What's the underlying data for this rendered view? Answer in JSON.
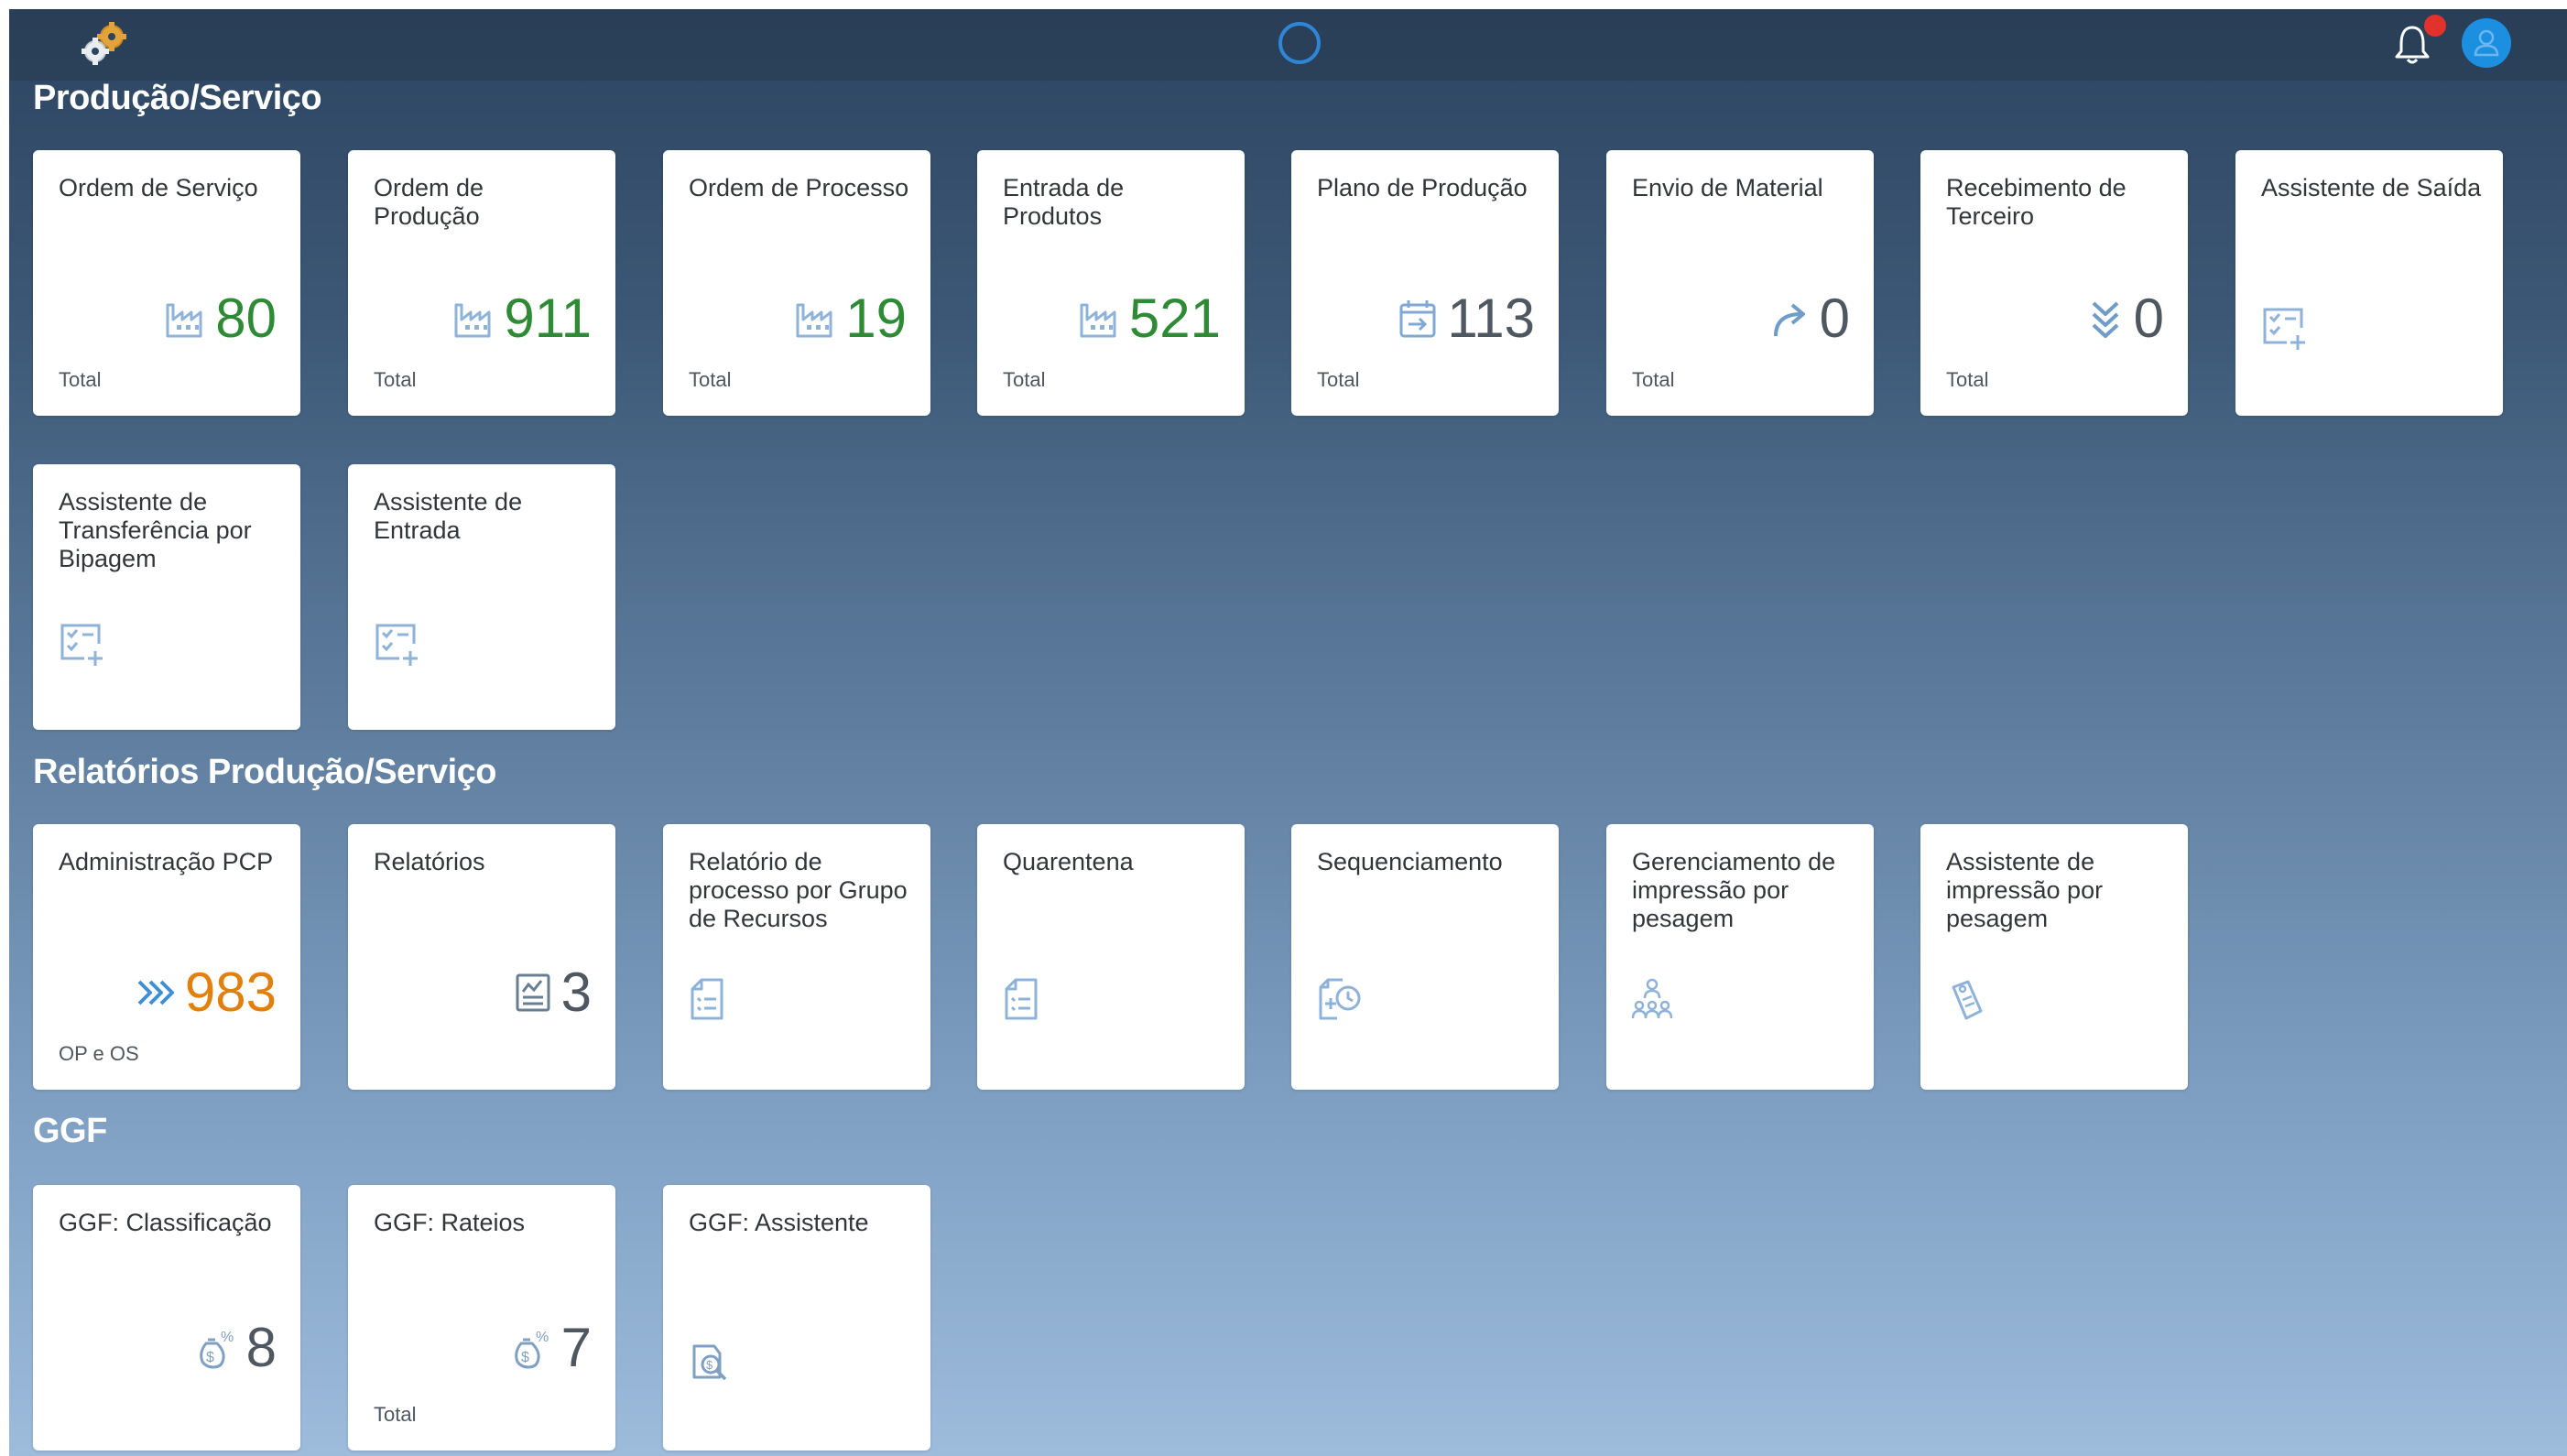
{
  "header": {
    "logo_icon": "gears-logo-icon",
    "loading_icon": "busy-indicator-icon",
    "notifications_icon": "bell-icon",
    "avatar_icon": "user-avatar-icon"
  },
  "colors": {
    "kpi_green": "#2f8a36",
    "kpi_orange": "#e0800f",
    "kpi_neutral": "#4f5760",
    "icon_blue": "#5b93c8",
    "avatar": "#1d8fe0",
    "badge": "#e3322b"
  },
  "sections": [
    {
      "title": "Produção/Serviço",
      "tiles": [
        {
          "title": "Ordem de Serviço",
          "value": "80",
          "icon": "factory-icon",
          "footer": "Total"
        },
        {
          "title": "Ordem de Produção",
          "value": "911",
          "icon": "factory-icon",
          "footer": "Total"
        },
        {
          "title": "Ordem de Processo",
          "value": "19",
          "icon": "factory-icon",
          "footer": "Total"
        },
        {
          "title": "Entrada de Produtos",
          "value": "521",
          "icon": "factory-icon",
          "footer": "Total"
        },
        {
          "title": "Plano de Produção",
          "value": "113",
          "icon": "calendar-arrow-icon",
          "footer": "Total"
        },
        {
          "title": "Envio de Material",
          "value": "0",
          "icon": "forward-arrow-icon",
          "footer": "Total"
        },
        {
          "title": "Recebimento de Terceiro",
          "value": "0",
          "icon": "double-chevron-down-icon",
          "footer": "Total"
        },
        {
          "title": "Assistente de Saída",
          "icon": "task-add-icon"
        },
        {
          "title": "Assistente de Transferência por Bipagem",
          "icon": "task-add-icon"
        },
        {
          "title": "Assistente de Entrada",
          "icon": "task-add-icon"
        }
      ]
    },
    {
      "title": "Relatórios Produção/Serviço",
      "tiles": [
        {
          "title": "Administração PCP",
          "value": "983",
          "icon": "triple-chevron-right-icon",
          "footer": "OP e OS"
        },
        {
          "title": "Relatórios",
          "value": "3",
          "icon": "report-chart-icon"
        },
        {
          "title": "Relatório de processo por Grupo de Recursos",
          "icon": "document-list-icon"
        },
        {
          "title": "Quarentena",
          "icon": "document-list-icon"
        },
        {
          "title": "Sequenciamento",
          "icon": "document-clock-icon"
        },
        {
          "title": "Gerenciamento de impressão por pesagem",
          "icon": "people-group-icon"
        },
        {
          "title": "Assistente de impressão por pesagem",
          "icon": "tag-print-icon"
        }
      ]
    },
    {
      "title": "GGF",
      "tiles": [
        {
          "title": "GGF: Classificação",
          "value": "8",
          "icon": "money-bag-percent-icon"
        },
        {
          "title": "GGF: Rateios",
          "value": "7",
          "icon": "money-bag-percent-icon",
          "footer": "Total"
        },
        {
          "title": "GGF: Assistente",
          "icon": "money-search-icon"
        }
      ]
    }
  ]
}
